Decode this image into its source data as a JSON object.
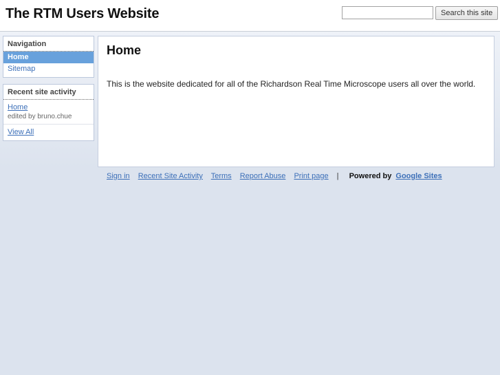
{
  "header": {
    "site_title": "The RTM Users Website",
    "search": {
      "value": "",
      "button_label": "Search this site"
    }
  },
  "sidebar": {
    "navigation": {
      "title": "Navigation",
      "items": [
        {
          "label": "Home",
          "selected": true
        },
        {
          "label": "Sitemap",
          "selected": false
        }
      ]
    },
    "recent_activity": {
      "title": "Recent site activity",
      "entries": [
        {
          "link": "Home",
          "meta": "edited by bruno.chue"
        }
      ],
      "view_all_label": "View All"
    }
  },
  "main": {
    "page_title": "Home",
    "body_text": "This is the website dedicated for all of the Richardson Real Time Microscope users all over the world."
  },
  "footer": {
    "links": [
      "Sign in",
      "Recent Site Activity",
      "Terms",
      "Report Abuse",
      "Print page"
    ],
    "separator": "|",
    "powered_by_label": "Powered by",
    "powered_by_link": "Google Sites"
  },
  "colors": {
    "page_background": "#dee4ef",
    "header_background": "#ffffff",
    "selected_item_background": "#68a1dc",
    "link_blue": "#3c6fb8",
    "box_border": "#bcc8dc"
  }
}
